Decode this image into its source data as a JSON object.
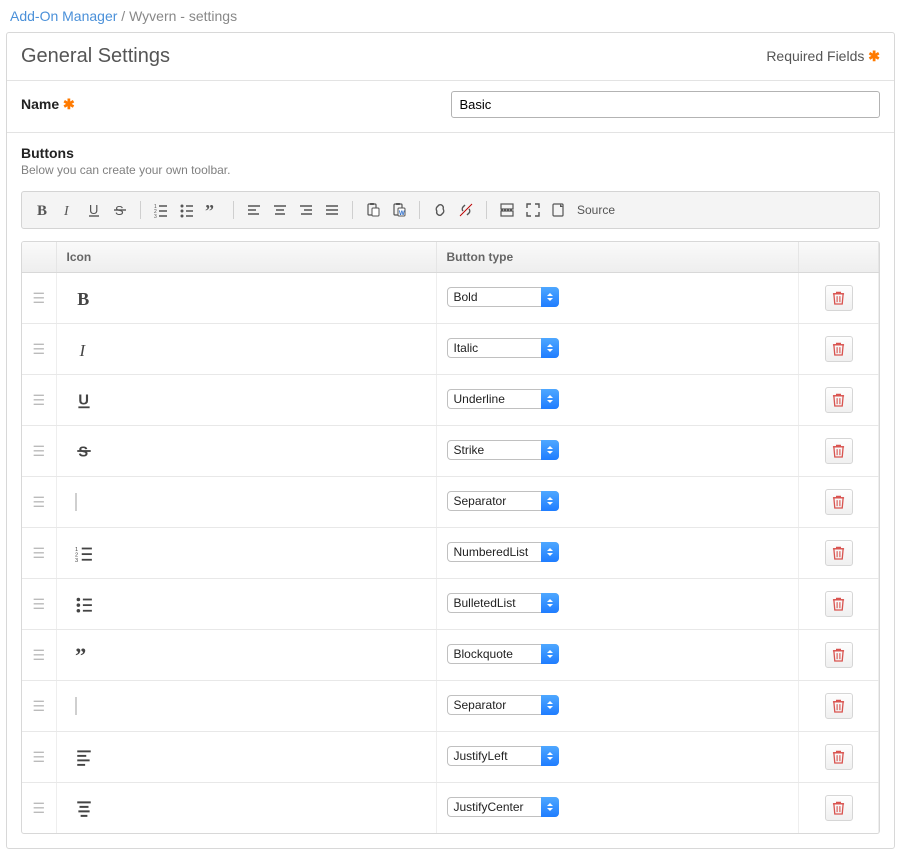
{
  "breadcrumb": {
    "link_label": "Add-On Manager",
    "separator": " / ",
    "current": "Wyvern - settings"
  },
  "panel": {
    "title": "General Settings",
    "required_note": "Required Fields"
  },
  "name_field": {
    "label": "Name",
    "value": "Basic"
  },
  "buttons_section": {
    "title": "Buttons",
    "desc": "Below you can create your own toolbar.",
    "source_label": "Source"
  },
  "table": {
    "columns": {
      "icon": "Icon",
      "type": "Button type"
    },
    "rows": [
      {
        "icon": "bold",
        "type": "Bold"
      },
      {
        "icon": "italic",
        "type": "Italic"
      },
      {
        "icon": "underline",
        "type": "Underline"
      },
      {
        "icon": "strike",
        "type": "Strike"
      },
      {
        "icon": "separator",
        "type": "Separator"
      },
      {
        "icon": "numberedlist",
        "type": "NumberedList"
      },
      {
        "icon": "bulletedlist",
        "type": "BulletedList"
      },
      {
        "icon": "blockquote",
        "type": "Blockquote"
      },
      {
        "icon": "separator",
        "type": "Separator"
      },
      {
        "icon": "justifyleft",
        "type": "JustifyLeft"
      },
      {
        "icon": "justifycenter",
        "type": "JustifyCenter"
      }
    ]
  }
}
